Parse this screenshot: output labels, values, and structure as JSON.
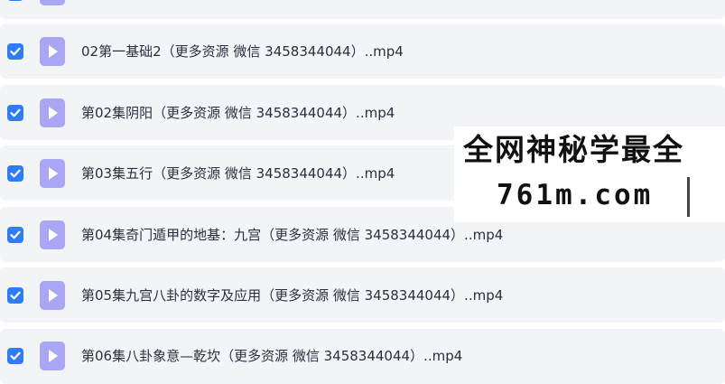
{
  "files": [
    {
      "name": "",
      "checked": true
    },
    {
      "name": "02第一基础2（更多资源 微信 3458344044）..mp4",
      "checked": true
    },
    {
      "name": "第02集阴阳（更多资源 微信 3458344044）..mp4",
      "checked": true
    },
    {
      "name": "第03集五行（更多资源 微信 3458344044）..mp4",
      "checked": true
    },
    {
      "name": "第04集奇门遁甲的地基：九宫（更多资源 微信 3458344044）..mp4",
      "checked": true
    },
    {
      "name": "第05集九宫八卦的数字及应用（更多资源 微信 3458344044）..mp4",
      "checked": true
    },
    {
      "name": "第06集八卦象意—乾坎（更多资源 微信 3458344044）..mp4",
      "checked": true
    }
  ],
  "watermark": {
    "line1": "全网神秘学最全",
    "line2": "761m.com"
  },
  "colors": {
    "checkbox": "#2f7cf6",
    "file_icon": "#a9a6f5",
    "row_background": "#f3f4f8",
    "text": "#2b2f3a"
  }
}
